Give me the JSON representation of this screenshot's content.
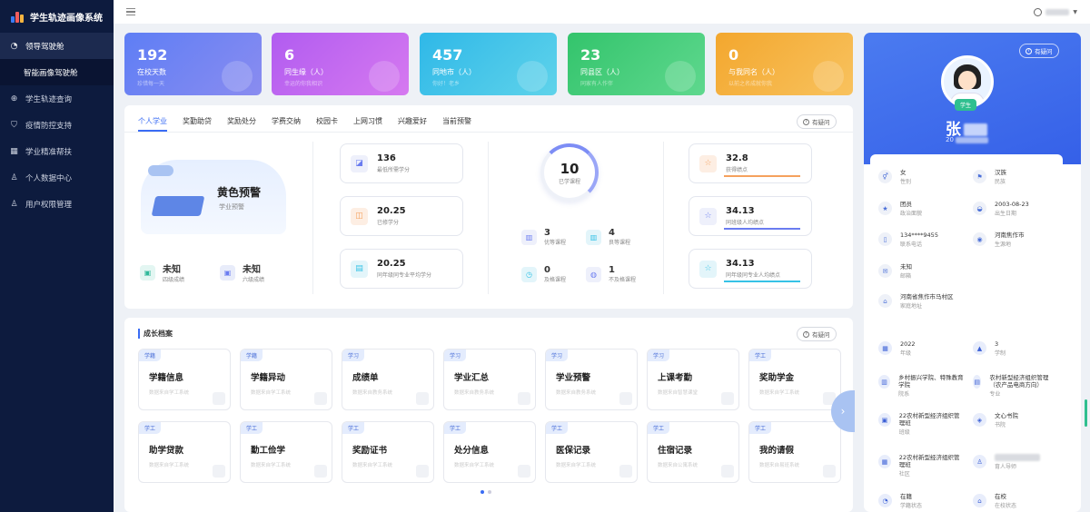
{
  "app": {
    "title": "学生轨迹画像系统"
  },
  "sidebar": {
    "items": [
      {
        "label": "领导驾驶舱",
        "icon": "dashboard-icon"
      },
      {
        "label": "智能画像驾驶舱",
        "icon": ""
      },
      {
        "label": "学生轨迹查询",
        "icon": "globe-icon"
      },
      {
        "label": "疫情防控支持",
        "icon": "shield-icon"
      },
      {
        "label": "学业精准帮扶",
        "icon": "grid-icon"
      },
      {
        "label": "个人数据中心",
        "icon": "user-group-icon"
      },
      {
        "label": "用户权限管理",
        "icon": "user-icon"
      }
    ]
  },
  "stats": [
    {
      "value": "192",
      "label": "在校天数",
      "sub": "珍惜每一天",
      "color": "#6a7cf0"
    },
    {
      "value": "6",
      "label": "同生缘（人）",
      "sub": "幸运的你我相识",
      "color": "#c260ee"
    },
    {
      "value": "457",
      "label": "同地市（人）",
      "sub": "你好！老乡",
      "color": "#36c2e6"
    },
    {
      "value": "23",
      "label": "同县区（人）",
      "sub": "同家有人作伴",
      "color": "#3fca79"
    },
    {
      "value": "0",
      "label": "与我同名（人）",
      "sub": "以前之名成就你我",
      "color": "#f5b440"
    }
  ],
  "tabs": [
    "个人学业",
    "奖勤助贷",
    "奖励处分",
    "学费交纳",
    "校园卡",
    "上网习惯",
    "兴趣爱好",
    "当前预警"
  ],
  "help_label": "有疑问",
  "warning": {
    "title": "黄色预警",
    "sub": "学业预警"
  },
  "cet": [
    {
      "value": "未知",
      "label": "四级成绩"
    },
    {
      "value": "未知",
      "label": "六级成绩"
    }
  ],
  "credits": [
    {
      "value": "136",
      "label": "最低所需学分"
    },
    {
      "value": "20.25",
      "label": "已修学分"
    },
    {
      "value": "20.25",
      "label": "同年级同专业平均学分"
    }
  ],
  "courses": {
    "total": "10",
    "total_label": "已学课程",
    "items": [
      {
        "value": "3",
        "label": "优等课程"
      },
      {
        "value": "4",
        "label": "良等课程"
      },
      {
        "value": "0",
        "label": "及格课程"
      },
      {
        "value": "1",
        "label": "不及格课程"
      }
    ]
  },
  "scores": [
    {
      "value": "32.8",
      "label": "获得绩点",
      "color": "#f5a15d"
    },
    {
      "value": "34.13",
      "label": "同班级人均绩点",
      "color": "#6a7cf0"
    },
    {
      "value": "34.13",
      "label": "同年级同专业人均绩点",
      "color": "#36c2e6"
    }
  ],
  "growth": {
    "title": "成长档案",
    "desc": "数据来自学工系统",
    "cards": [
      {
        "tag": "学籍",
        "name": "学籍信息",
        "desc": "数据来自学工系统"
      },
      {
        "tag": "学籍",
        "name": "学籍异动",
        "desc": "数据来自学工系统"
      },
      {
        "tag": "学习",
        "name": "成绩单",
        "desc": "数据来自教务系统"
      },
      {
        "tag": "学习",
        "name": "学业汇总",
        "desc": "数据来自教务系统"
      },
      {
        "tag": "学习",
        "name": "学业预警",
        "desc": "数据来自教务系统"
      },
      {
        "tag": "学习",
        "name": "上课考勤",
        "desc": "数据来自智慧课堂"
      },
      {
        "tag": "学工",
        "name": "奖助学金",
        "desc": "数据来自学工系统"
      },
      {
        "tag": "学工",
        "name": "助学贷款",
        "desc": "数据来自学工系统"
      },
      {
        "tag": "学工",
        "name": "勤工俭学",
        "desc": "数据来自学工系统"
      },
      {
        "tag": "学工",
        "name": "奖励证书",
        "desc": "数据来自学工系统"
      },
      {
        "tag": "学工",
        "name": "处分信息",
        "desc": "数据来自学工系统"
      },
      {
        "tag": "学工",
        "name": "医保记录",
        "desc": "数据来自学工系统"
      },
      {
        "tag": "学工",
        "name": "住宿记录",
        "desc": "数据来自公寓系统"
      },
      {
        "tag": "学工",
        "name": "我的请假",
        "desc": "数据来自易班系统"
      }
    ]
  },
  "profile": {
    "student_tag": "学生",
    "name": "张",
    "id": "20",
    "fields": [
      {
        "value": "女",
        "label": "性别",
        "icon": "gender-icon"
      },
      {
        "value": "汉族",
        "label": "民族",
        "icon": "flag-icon"
      },
      {
        "value": "团员",
        "label": "政治面貌",
        "icon": "badge-icon"
      },
      {
        "value": "2003-08-23",
        "label": "出生日期",
        "icon": "cake-icon"
      },
      {
        "value": "134****9455",
        "label": "联系电话",
        "icon": "phone-icon"
      },
      {
        "value": "河南焦作市",
        "label": "生源地",
        "icon": "location-icon"
      },
      {
        "value": "未知",
        "label": "邮箱",
        "icon": "mail-icon"
      },
      {
        "value": "河南省焦作市马村区",
        "label": "家庭地址",
        "icon": "home-icon"
      },
      {
        "value": "2022",
        "label": "年级",
        "icon": "calendar-icon"
      },
      {
        "value": "3",
        "label": "学制",
        "icon": "graduation-icon"
      },
      {
        "value": "乡村振兴学院、特殊教育学院",
        "label": "院系",
        "icon": "building-icon"
      },
      {
        "value": "农村新型经济组织管理（农产品电商方向）",
        "label": "专业",
        "icon": "book-icon"
      },
      {
        "value": "22农村新型经济组织管理班",
        "label": "班级",
        "icon": "class-icon"
      },
      {
        "value": "文心书院",
        "label": "书院",
        "icon": "layers-icon"
      },
      {
        "value": "22农村新型经济组织管理班",
        "label": "社区",
        "icon": "community-icon"
      },
      {
        "value": "",
        "label": "育人导师",
        "icon": "mentor-icon"
      },
      {
        "value": "在籍",
        "label": "学籍状态",
        "icon": "status-icon"
      },
      {
        "value": "在校",
        "label": "在校状态",
        "icon": "school-icon"
      }
    ]
  }
}
